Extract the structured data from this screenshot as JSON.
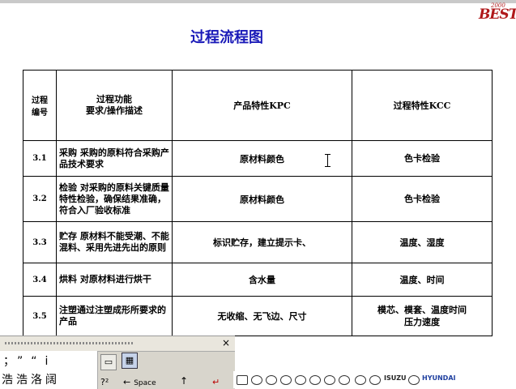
{
  "slide": {
    "title": "过程流程图",
    "logo": {
      "text": "BEST",
      "year": "2000"
    }
  },
  "table": {
    "headers": {
      "no_line1": "过程",
      "no_line2": "编号",
      "desc_line1": "过程功能",
      "desc_line2": "要求/操作描述",
      "kpc": "产品特性KPC",
      "kcc": "过程特性KCC"
    },
    "rows": [
      {
        "no": "3.1",
        "desc": "采购 采购的原料符合采购产品技术要求",
        "kpc": "原材料颜色",
        "kcc": "色卡检验"
      },
      {
        "no": "3.2",
        "desc": "检验 对采购的原料关键质量特性检验，确保结果准确，符合入厂验收标准",
        "kpc": "原材料颜色",
        "kcc": "色卡检验"
      },
      {
        "no": "3.3",
        "desc": "贮存 原材料不能受潮、不能混料、采用先进先出的原则",
        "kpc": "标识贮存，建立提示卡、",
        "kcc": "温度、湿度"
      },
      {
        "no": "3.4",
        "desc": "烘料 对原材料进行烘干",
        "kpc": "含水量",
        "kcc": "温度、时间"
      },
      {
        "no": "3.5",
        "desc": "注塑通过注塑成形所要求的产品",
        "kpc": "无收缩、无飞边、尺寸",
        "kcc_line1": "模芯、模套、温度时间",
        "kcc_line2": "压力速度"
      }
    ]
  },
  "ime": {
    "close": "×",
    "punct_row": "；”“i",
    "char_row": "浩浩洛阔",
    "key_question": "?²",
    "key_space_arrow": "←",
    "key_space": "Space",
    "key_up": "↑",
    "key_enter": "↵"
  },
  "brands": {
    "isuzu": "ISUZU",
    "hyundai": "HYUNDAI"
  }
}
